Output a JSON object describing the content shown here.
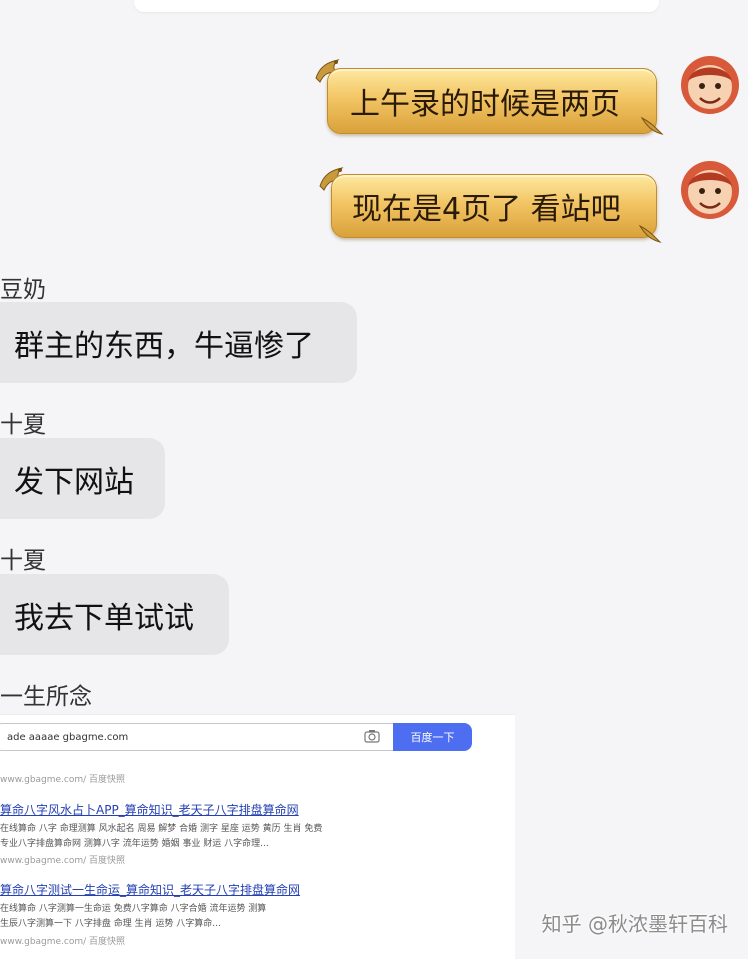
{
  "messages": {
    "sent_1": "上午录的时候是两页",
    "sent_2": "现在是4页了 看站吧",
    "sender_1": "豆奶",
    "recv_1": "群主的东西，牛逼惨了",
    "sender_2": "十夏",
    "recv_2": "发下网站",
    "sender_3": "十夏",
    "recv_3": "我去下单试试",
    "sender_4": "一生所念"
  },
  "screenshot": {
    "query": "ade aaaae gbagme.com",
    "button": "百度一下",
    "results": [
      {
        "meta": "www.gbagme.com/ 百度快照",
        "title": "算命八字风水占卜APP_算命知识_老天子八字排盘算命网",
        "snippet_1": "在线算命 八字 命理测算 风水起名 周易 解梦 合婚 测字 星座 运势 黄历 生肖 免费",
        "snippet_2": "专业八字排盘算命网 测算八字 流年运势 婚姻 事业 财运 八字命理...",
        "source": "www.gbagme.com/ 百度快照"
      },
      {
        "meta": "",
        "title": "算命八字测试一生命运_算命知识_老天子八字排盘算命网",
        "snippet_1": "在线算命 八字测算一生命运 免费八字算命 八字合婚 流年运势 测算",
        "snippet_2": "生辰八字测算一下 八字排盘 命理 生肖 运势 八字算命...",
        "source": "www.gbagme.com/ 百度快照"
      }
    ]
  },
  "watermark": "知乎 @秋浓墨轩百科",
  "colors": {
    "gold": "#f3c565",
    "bubble_gray": "#e6e6e9",
    "link_blue": "#2440b3",
    "button_blue": "#4e6ef2"
  }
}
